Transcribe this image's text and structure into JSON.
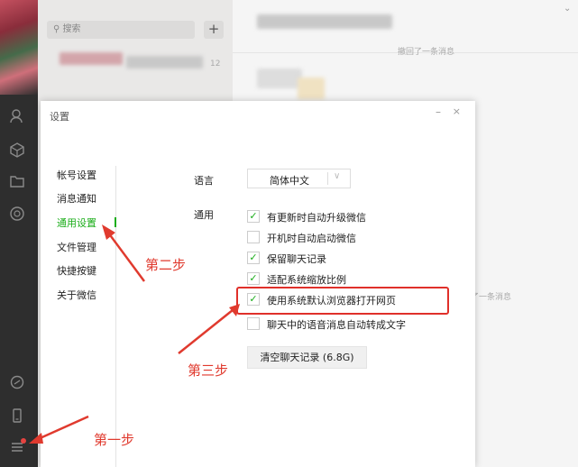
{
  "search": {
    "placeholder": "搜索"
  },
  "list": {
    "unread_count": "12"
  },
  "chat": {
    "recall_notice_1": "撤回了一条消息",
    "recall_notice_2": "了一条消息"
  },
  "dialog": {
    "title": "设置",
    "nav": [
      "帐号设置",
      "消息通知",
      "通用设置",
      "文件管理",
      "快捷按键",
      "关于微信"
    ],
    "language_label": "语言",
    "language_value": "简体中文",
    "general_label": "通用",
    "options": [
      {
        "label": "有更新时自动升级微信",
        "checked": true
      },
      {
        "label": "开机时自动启动微信",
        "checked": false
      },
      {
        "label": "保留聊天记录",
        "checked": true
      },
      {
        "label": "适配系统缩放比例",
        "checked": true
      },
      {
        "label": "使用系统默认浏览器打开网页",
        "checked": true
      },
      {
        "label": "聊天中的语音消息自动转成文字",
        "checked": false
      }
    ],
    "clear_button": "清空聊天记录 (6.8G)"
  },
  "annotations": {
    "step1": "第一步",
    "step2": "第二步",
    "step3": "第三步"
  },
  "colors": {
    "accent_green": "#1aad19",
    "annotation_red": "#e03a2e"
  }
}
